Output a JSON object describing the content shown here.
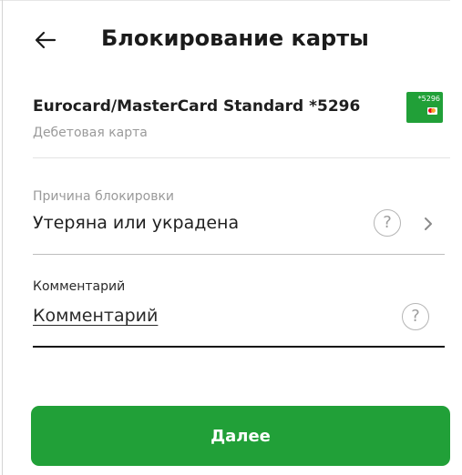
{
  "header": {
    "title": "Блокирование карты",
    "back_icon": "arrow-left-icon"
  },
  "card": {
    "name": "Eurocard/MasterCard Standard *5296",
    "type": "Дебетовая карта",
    "thumb_number": "*5296",
    "thumb_color": "#21a038"
  },
  "reason": {
    "label": "Причина блокировки",
    "value": "Утеряна или украдена",
    "help_icon": "question-circle-icon",
    "chevron_icon": "chevron-right-icon"
  },
  "comment": {
    "label": "Комментарий",
    "placeholder": "Комментарий",
    "value": "",
    "help_icon": "question-circle-icon"
  },
  "help_glyph": "?",
  "actions": {
    "next_label": "Далее",
    "accent_color": "#21a038"
  }
}
